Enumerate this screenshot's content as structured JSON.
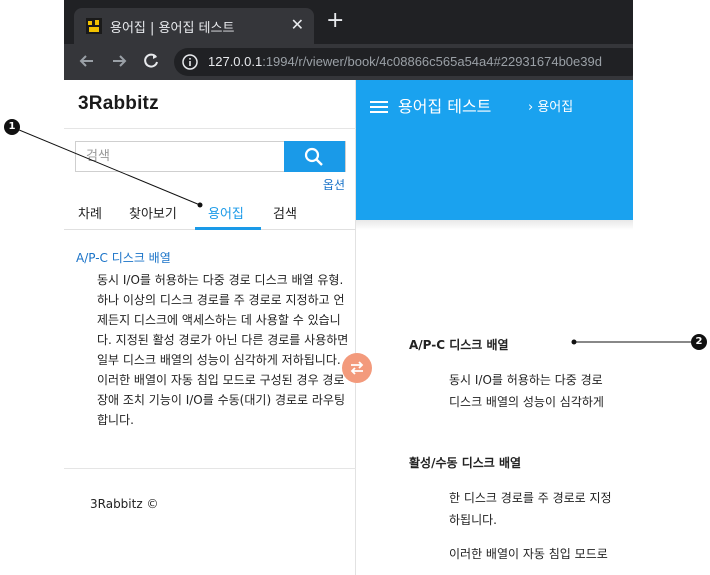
{
  "browser": {
    "tab_title": "용어집 | 용어집 테스트",
    "close_glyph": "✕",
    "newtab_glyph": "+",
    "url_host": "127.0.0.1",
    "url_rest": ":1994/r/viewer/book/4c08866c565a54a4#22931674b0e39d"
  },
  "sidebar": {
    "logo_prefix": "3",
    "logo_rest": "Rabbitz",
    "search_placeholder": "검색",
    "options_label": "옵션",
    "tabs": [
      {
        "label": "차례"
      },
      {
        "label": "찾아보기"
      },
      {
        "label": "용어집"
      },
      {
        "label": "검색"
      }
    ],
    "glossary_term": "A/P-C 디스크 배열",
    "glossary_definition": "동시 I/O를 허용하는 다중 경로 디스크 배열 유형. 하나 이상의 디스크 경로를 주 경로로 지정하고 언제든지 디스크에 액세스하는 데 사용할 수 있습니다. 지정된 활성 경로가 아닌 다른 경로를 사용하면 일부 디스크 배열의 성능이 심각하게 저하됩니다. 이러한 배열이 자동 침입 모드로 구성된 경우 경로 장애 조치 기능이 I/O를 수동(대기) 경로로 라우팅합니다.",
    "footer": "3Rabbitz ©"
  },
  "content": {
    "doc_title": "용어집 테스트",
    "breadcrumb": "› 용어집",
    "entries": [
      {
        "term": "A/P-C 디스크 배열",
        "def_line1": "동시 I/O를 허용하는 다중 경로",
        "def_line2": "디스크 배열의 성능이 심각하게"
      },
      {
        "term": "활성/수동 디스크 배열",
        "def_line1": "한 디스크 경로를 주 경로로 지정",
        "def_line2": "하됩니다.",
        "def_line3": "이러한 배열이 자동 침입 모드로"
      }
    ]
  },
  "annotations": {
    "one": "1",
    "two": "2"
  },
  "colors": {
    "accent": "#1aa2ef",
    "toggle": "#f39a7c",
    "link": "#1a73c8"
  }
}
